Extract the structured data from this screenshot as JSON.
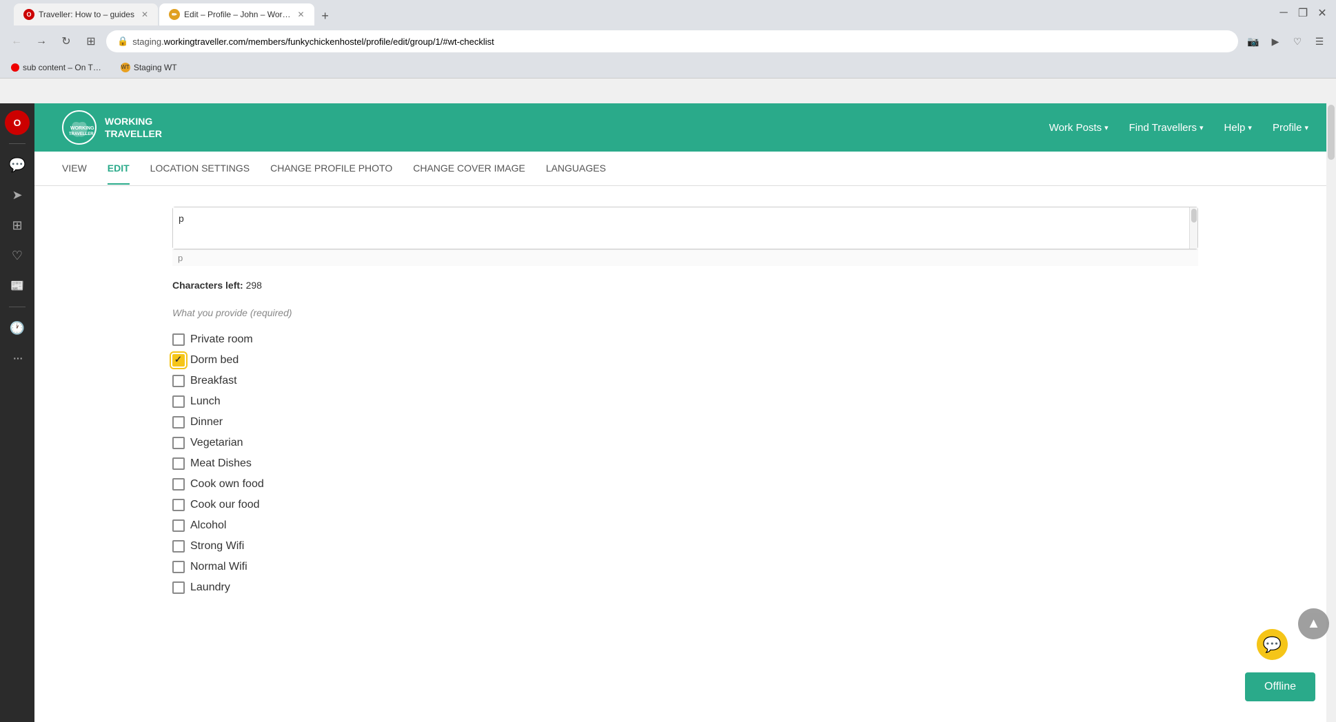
{
  "browser": {
    "title_bar": {
      "tabs": [
        {
          "id": "tab1",
          "label": "Traveller: How to – guides",
          "active": false,
          "favicon_type": "opera"
        },
        {
          "id": "tab2",
          "label": "Edit – Profile – John – Wor…",
          "active": true,
          "favicon_type": "edit"
        }
      ],
      "new_tab_label": "+"
    },
    "address_bar": {
      "url_display": "staging.workingtraveller.com/members/funkychickenhostel/profile/edit/group/1/#wt-checklist",
      "secure": true
    },
    "bookmarks": [
      {
        "label": "sub content – On T…",
        "type": "red"
      },
      {
        "label": "Staging WT",
        "type": "wt"
      }
    ]
  },
  "left_sidebar": {
    "icons": [
      {
        "name": "opera-icon",
        "label": "O"
      },
      {
        "name": "chat-icon",
        "label": "💬"
      },
      {
        "name": "send-icon",
        "label": "➤"
      },
      {
        "name": "apps-icon",
        "label": "⊞"
      },
      {
        "name": "heart-icon",
        "label": "♡"
      },
      {
        "name": "news-icon",
        "label": "📰"
      },
      {
        "name": "history-icon",
        "label": "🕐"
      },
      {
        "name": "more-icon",
        "label": "•••"
      }
    ]
  },
  "site_header": {
    "logo_text": "WORKING\nTRAVELLER",
    "nav_items": [
      {
        "label": "Work Posts",
        "has_dropdown": true
      },
      {
        "label": "Find Travellers",
        "has_dropdown": true
      },
      {
        "label": "Help",
        "has_dropdown": true
      },
      {
        "label": "Profile",
        "has_dropdown": true
      }
    ]
  },
  "page_nav": {
    "items": [
      {
        "label": "VIEW",
        "active": false
      },
      {
        "label": "EDIT",
        "active": true
      },
      {
        "label": "LOCATION SETTINGS",
        "active": false
      },
      {
        "label": "CHANGE PROFILE PHOTO",
        "active": false
      },
      {
        "label": "CHANGE COVER IMAGE",
        "active": false
      },
      {
        "label": "LANGUAGES",
        "active": false
      }
    ]
  },
  "content": {
    "textarea": {
      "value": "p",
      "placeholder": ""
    },
    "chars_left_label": "Characters left:",
    "chars_left_value": "298",
    "what_you_provide_label": "What you provide (required)",
    "checklist_items": [
      {
        "id": "private_room",
        "label": "Private room",
        "checked": false,
        "focused": false
      },
      {
        "id": "dorm_bed",
        "label": "Dorm bed",
        "checked": true,
        "focused": true
      },
      {
        "id": "breakfast",
        "label": "Breakfast",
        "checked": false,
        "focused": false
      },
      {
        "id": "lunch",
        "label": "Lunch",
        "checked": false,
        "focused": false
      },
      {
        "id": "dinner",
        "label": "Dinner",
        "checked": false,
        "focused": false
      },
      {
        "id": "vegetarian",
        "label": "Vegetarian",
        "checked": false,
        "focused": false
      },
      {
        "id": "meat_dishes",
        "label": "Meat Dishes",
        "checked": false,
        "focused": false
      },
      {
        "id": "cook_own_food",
        "label": "Cook own food",
        "checked": false,
        "focused": false
      },
      {
        "id": "cook_our_food",
        "label": "Cook our food",
        "checked": false,
        "focused": false
      },
      {
        "id": "alcohol",
        "label": "Alcohol",
        "checked": false,
        "focused": false
      },
      {
        "id": "strong_wifi",
        "label": "Strong Wifi",
        "checked": false,
        "focused": false
      },
      {
        "id": "normal_wifi",
        "label": "Normal Wifi",
        "checked": false,
        "focused": false
      },
      {
        "id": "laundry",
        "label": "Laundry",
        "checked": false,
        "focused": false
      }
    ]
  },
  "offline_badge": {
    "label": "Offline"
  },
  "colors": {
    "brand_teal": "#2aaa8a",
    "focus_yellow": "#f5c518"
  }
}
